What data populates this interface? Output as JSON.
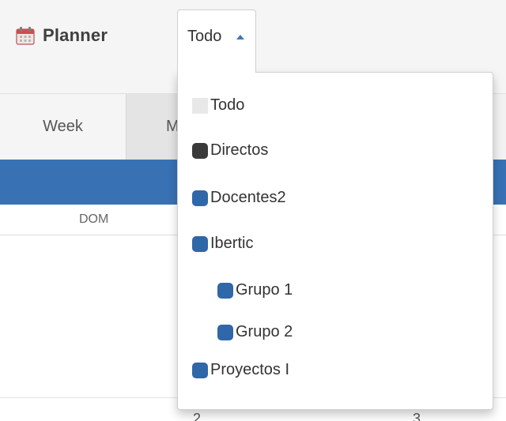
{
  "header": {
    "app_title": "Planner",
    "filter_label": "Todo",
    "caret_icon": "caret-up-icon",
    "calendar_icon": "calendar-icon"
  },
  "views": {
    "week_label": "Week",
    "month_label": "M"
  },
  "calendar": {
    "day_label": "DOM",
    "date_numbers": [
      "2",
      "3"
    ]
  },
  "dropdown": {
    "items": [
      {
        "label": "Todo",
        "color": "#e8e8e8",
        "level": 0
      },
      {
        "label": "Directos",
        "color": "#3a3a3a",
        "level": 0
      },
      {
        "label": "Docentes2",
        "color": "#2f67a8",
        "level": 0
      },
      {
        "label": "Ibertic",
        "color": "#2f67a8",
        "level": 0
      },
      {
        "label": "Grupo 1",
        "color": "#2f67a8",
        "level": 1
      },
      {
        "label": "Grupo 2",
        "color": "#2f67a8",
        "level": 1
      },
      {
        "label": "Proyectos I",
        "color": "#2f67a8",
        "level": 0
      }
    ]
  },
  "colors": {
    "accent_blue": "#3872b5",
    "text_dark": "#333333"
  }
}
